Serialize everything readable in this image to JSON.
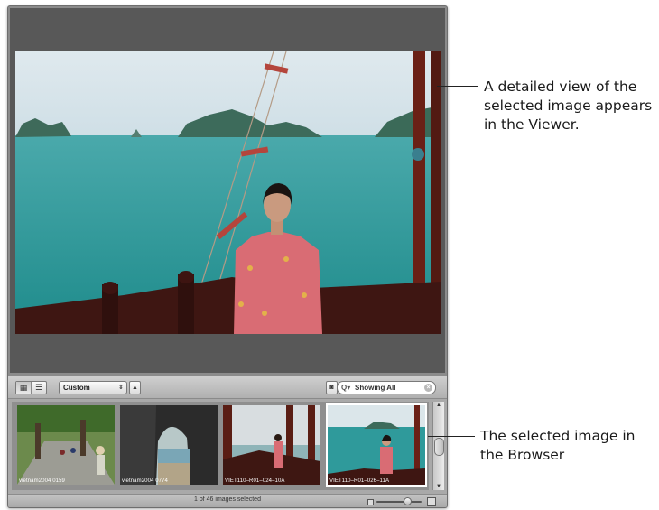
{
  "browser": {
    "view_modes": [
      "grid-view",
      "list-view"
    ],
    "filter_popup_value": "Custom",
    "search": {
      "value": "Showing All"
    },
    "thumbnails": [
      {
        "caption": "vietnam2004 0159",
        "selected": false
      },
      {
        "caption": "vietnam2004 0774",
        "selected": false
      },
      {
        "caption": "VIET110–R01–024–10A",
        "selected": false
      },
      {
        "caption": "VIET110–R01–026–11A",
        "selected": true
      }
    ],
    "status_text": "1 of 46 images selected"
  },
  "callouts": {
    "viewer": [
      "A detailed view of the",
      "selected image appears",
      "in the Viewer."
    ],
    "browser": [
      "The selected image in",
      "the Browser"
    ]
  },
  "colors": {
    "selection_border": "#ffffff",
    "viewer_background": "#585858",
    "browser_background": "#8f8f8f"
  }
}
